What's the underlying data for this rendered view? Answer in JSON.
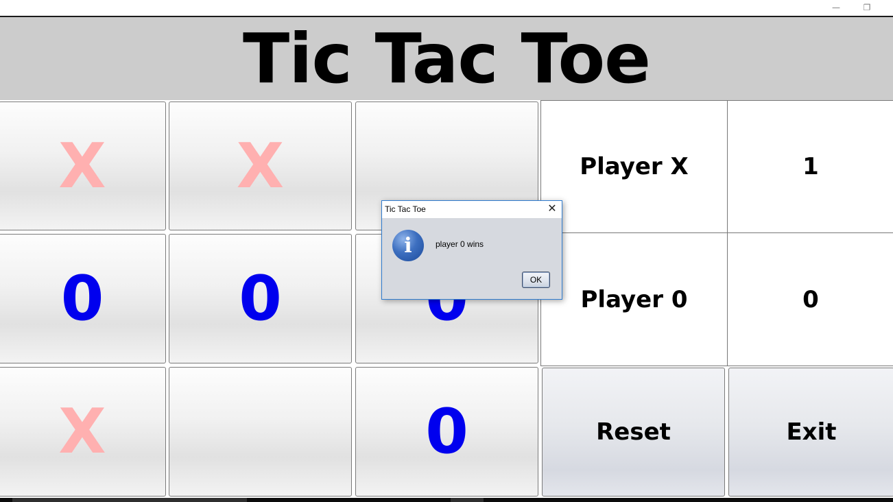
{
  "window": {
    "minimize_glyph": "—",
    "restore_glyph": "❐"
  },
  "header": {
    "title": "Tic Tac Toe"
  },
  "board": {
    "cells": [
      "X",
      "X",
      "",
      "0",
      "0",
      "0",
      "X",
      "",
      "0"
    ],
    "x_color": "#ffb0b0",
    "o_color": "#0000ee"
  },
  "scoreboard": {
    "player_x_label": "Player X",
    "player_x_score": "1",
    "player_o_label": "Player 0",
    "player_o_score": "0"
  },
  "actions": {
    "reset_label": "Reset",
    "exit_label": "Exit"
  },
  "dialog": {
    "title": "Tic Tac Toe",
    "close_glyph": "✕",
    "icon": "info-icon",
    "icon_glyph": "i",
    "message": "player 0 wins",
    "ok_label": "OK"
  }
}
